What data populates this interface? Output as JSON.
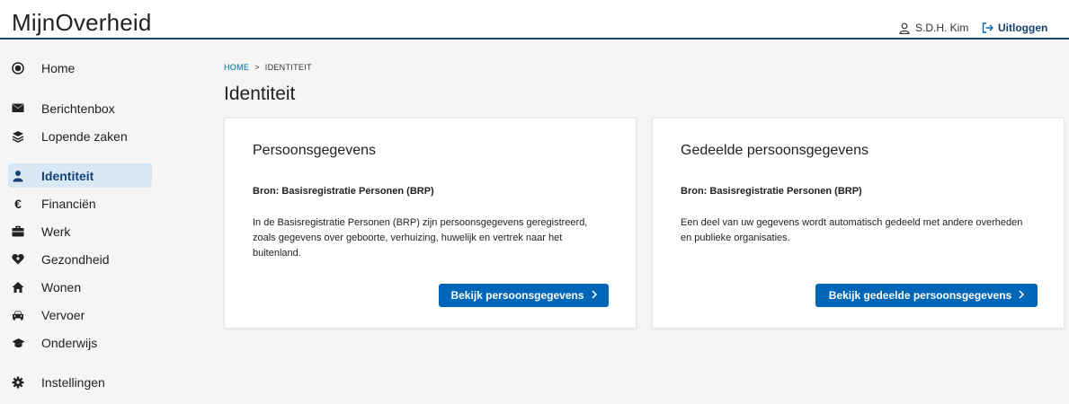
{
  "header": {
    "logo": "MijnOverheid",
    "user_name": "S.D.H. Kim",
    "logout_label": "Uitloggen"
  },
  "sidebar": {
    "items": [
      {
        "label": "Home",
        "icon": "home-circle-icon"
      },
      {
        "label": "Berichtenbox",
        "icon": "envelope-icon"
      },
      {
        "label": "Lopende zaken",
        "icon": "layers-icon"
      },
      {
        "label": "Identiteit",
        "icon": "person-icon",
        "active": true
      },
      {
        "label": "Financiën",
        "icon": "euro-icon"
      },
      {
        "label": "Werk",
        "icon": "briefcase-icon"
      },
      {
        "label": "Gezondheid",
        "icon": "heart-icon"
      },
      {
        "label": "Wonen",
        "icon": "house-icon"
      },
      {
        "label": "Vervoer",
        "icon": "car-icon"
      },
      {
        "label": "Onderwijs",
        "icon": "graduation-cap-icon"
      },
      {
        "label": "Instellingen",
        "icon": "gear-icon"
      }
    ]
  },
  "breadcrumb": {
    "home": "HOME",
    "separator": ">",
    "current": "IDENTITEIT"
  },
  "page_title": "Identiteit",
  "cards": [
    {
      "title": "Persoonsgegevens",
      "source": "Bron: Basisregistratie Personen (BRP)",
      "description_lines": [
        "In de Basisregistratie Personen (BRP) zijn persoonsgegevens geregistreerd,",
        "zoals gegevens over geboorte, verhuizing, huwelijk en vertrek naar het",
        "buitenland."
      ],
      "button_label": "Bekijk persoonsgegevens"
    },
    {
      "title": "Gedeelde persoonsgegevens",
      "source": "Bron: Basisregistratie Personen (BRP)",
      "description_lines": [
        "Een deel van uw gegevens wordt automatisch gedeeld met andere overheden",
        "en publieke organisaties."
      ],
      "button_label": "Bekijk gedeelde persoonsgegevens"
    }
  ],
  "colors": {
    "brand": "#154273",
    "button": "#0067b8",
    "active_nav": "#d9e8f5",
    "link": "#01689b"
  }
}
